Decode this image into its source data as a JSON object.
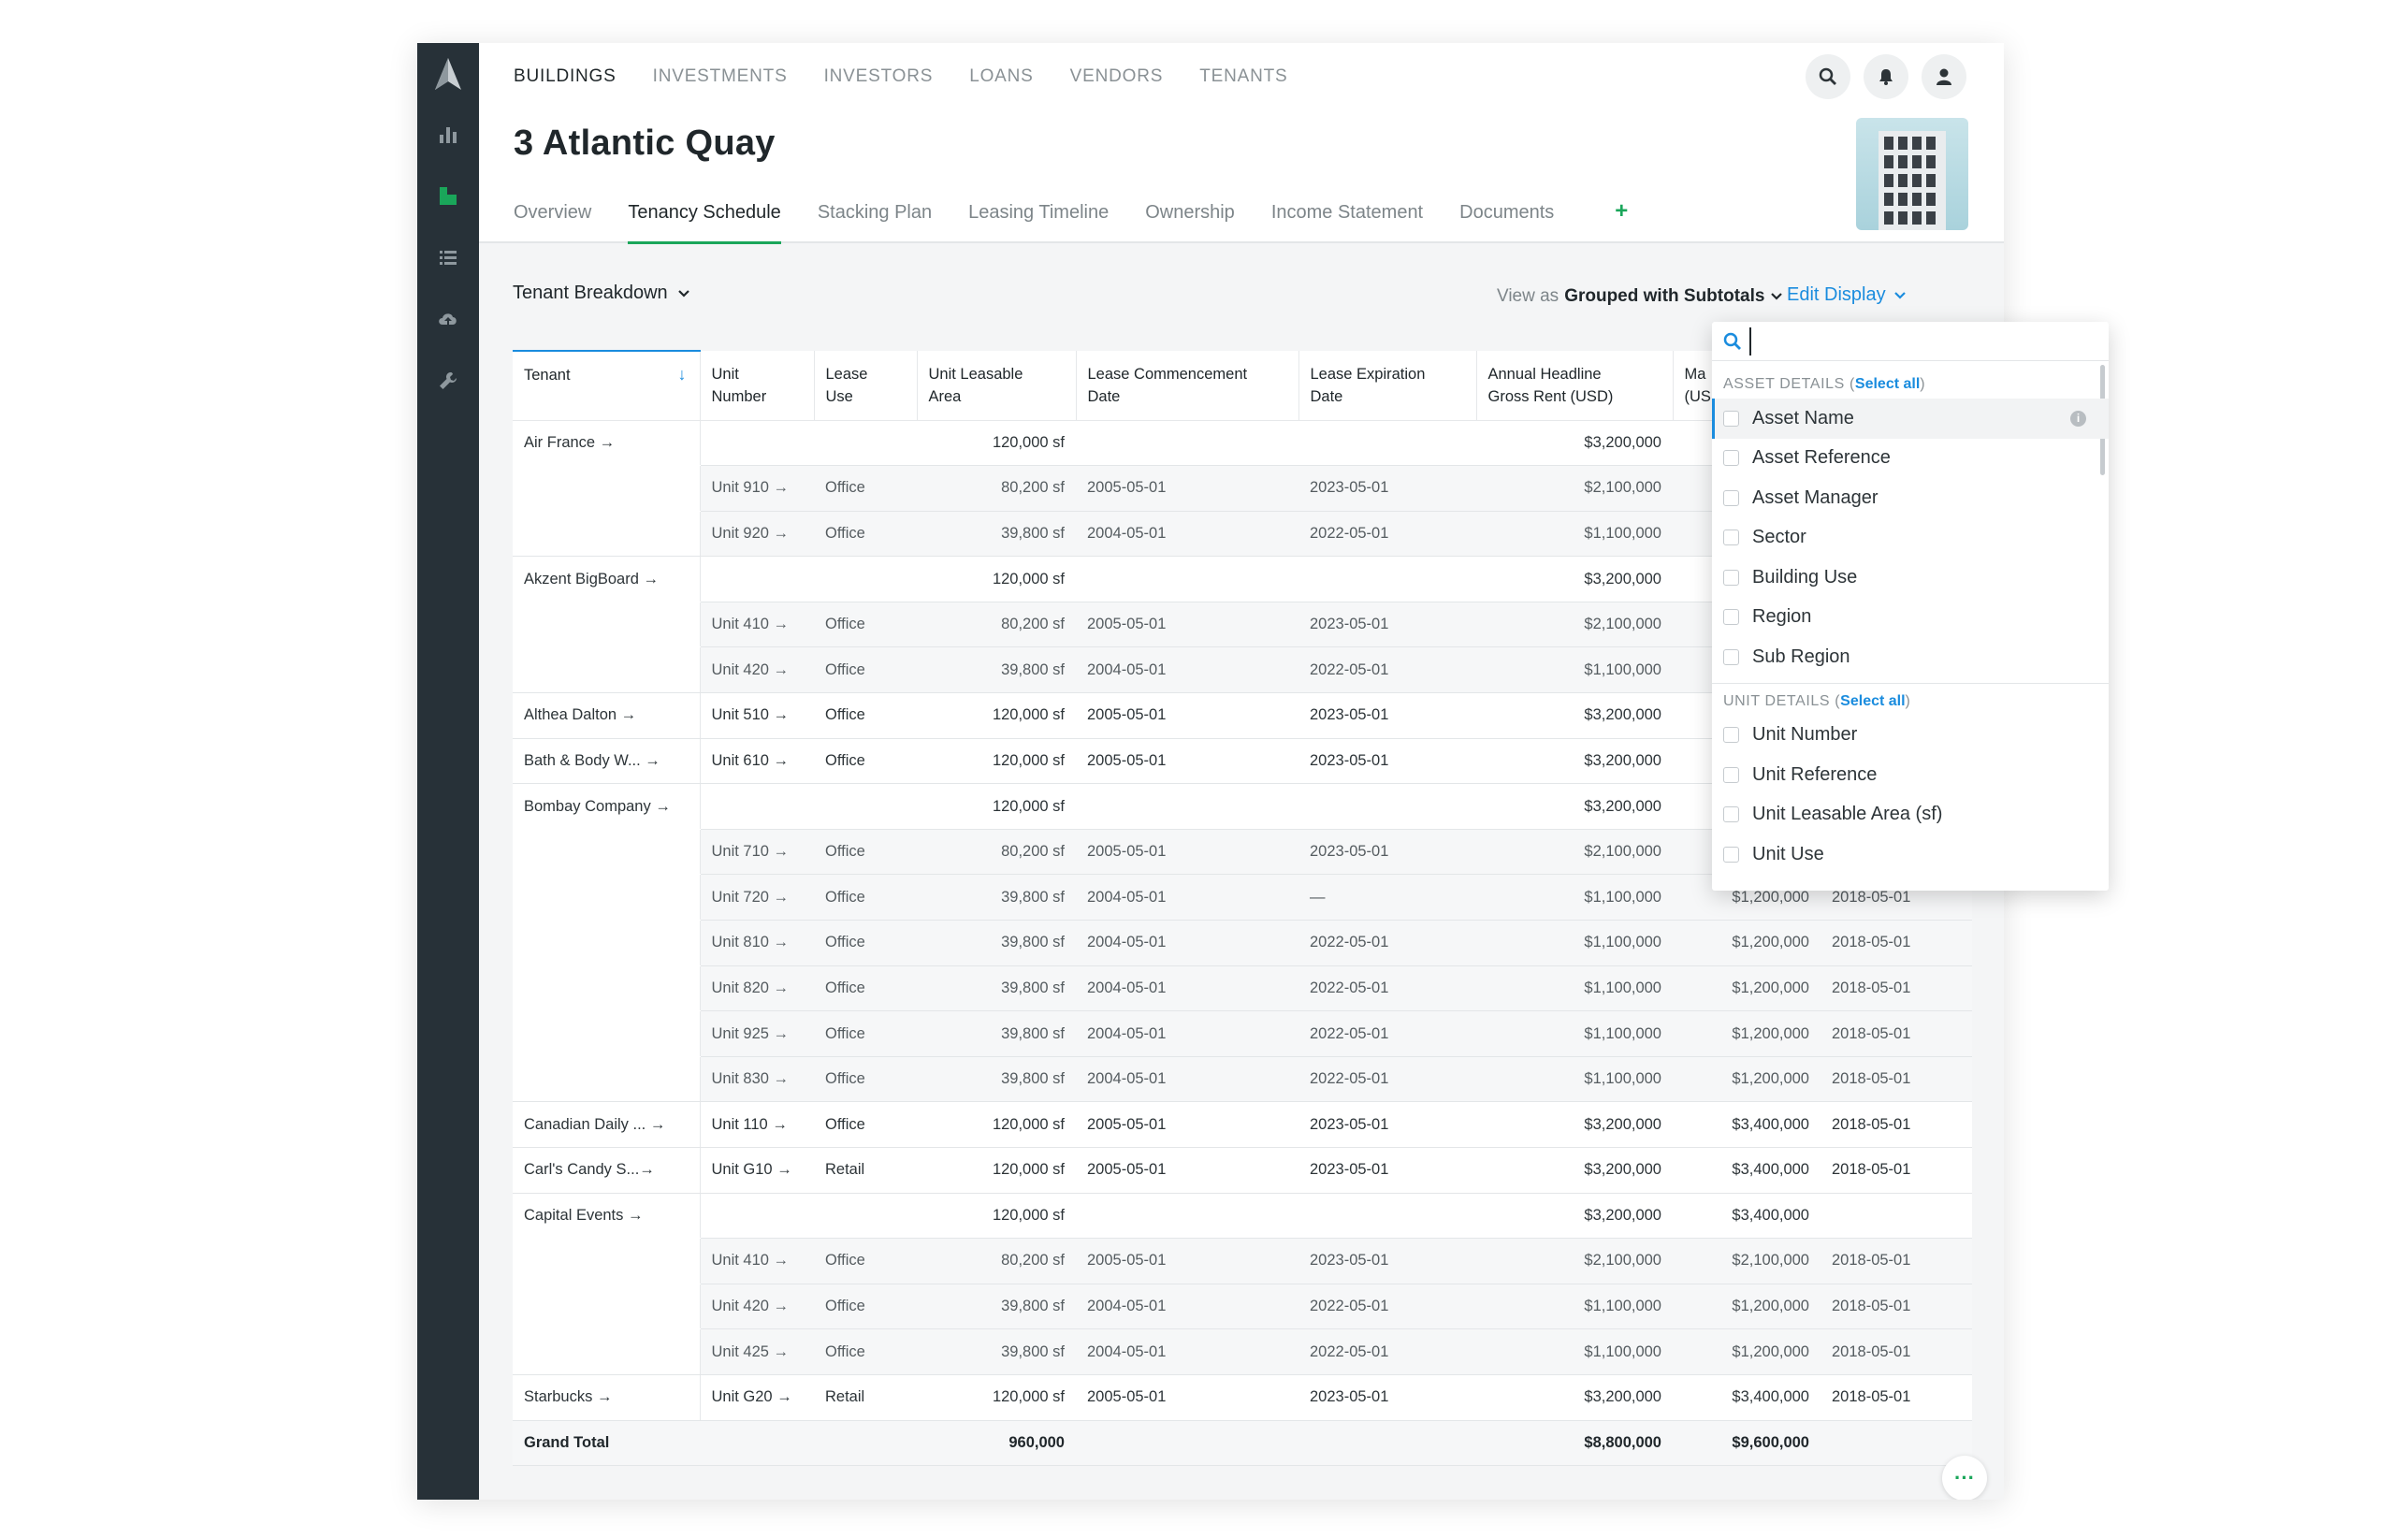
{
  "nav": {
    "items": [
      "BUILDINGS",
      "INVESTMENTS",
      "INVESTORS",
      "LOANS",
      "VENDORS",
      "TENANTS"
    ],
    "active": "BUILDINGS"
  },
  "page": {
    "title": "3 Atlantic Quay"
  },
  "tabs": {
    "items": [
      "Overview",
      "Tenancy Schedule",
      "Stacking Plan",
      "Leasing Timeline",
      "Ownership",
      "Income Statement",
      "Documents"
    ],
    "active": "Tenancy Schedule",
    "add": "+"
  },
  "toolbar": {
    "breakdown": "Tenant Breakdown",
    "view_as_label": "View as",
    "view_as_value": "Grouped with Subtotals",
    "edit_display": "Edit Display"
  },
  "table": {
    "headers": [
      "Tenant",
      "Unit Number",
      "Lease Use",
      "Unit Leasable Area",
      "Lease Commencement Date",
      "Lease Expiration Date",
      "Annual Headline Gross Rent (USD)",
      "Market Rent (USD)",
      ""
    ],
    "header_lines": [
      [
        "Tenant"
      ],
      [
        "Unit",
        "Number"
      ],
      [
        "Lease",
        "Use"
      ],
      [
        "Unit Leasable",
        "Area"
      ],
      [
        "Lease Commencement",
        "Date"
      ],
      [
        "Lease Expiration",
        "Date"
      ],
      [
        "Annual Headline",
        "Gross Rent (USD)"
      ],
      [
        "Ma",
        "(US"
      ],
      [
        ""
      ]
    ],
    "rows": [
      {
        "kind": "group",
        "cells": [
          "Air France →",
          "",
          "",
          "120,000 sf",
          "",
          "",
          "$3,200,000",
          "",
          ""
        ]
      },
      {
        "kind": "sub",
        "cells": [
          "",
          "Unit 910 →",
          "Office",
          "80,200 sf",
          "2005-05-01",
          "2023-05-01",
          "$2,100,000",
          "",
          ""
        ]
      },
      {
        "kind": "sub",
        "cells": [
          "",
          "Unit 920 →",
          "Office",
          "39,800 sf",
          "2004-05-01",
          "2022-05-01",
          "$1,100,000",
          "",
          ""
        ]
      },
      {
        "kind": "group",
        "cells": [
          "Akzent BigBoard →",
          "",
          "",
          "120,000 sf",
          "",
          "",
          "$3,200,000",
          "",
          ""
        ]
      },
      {
        "kind": "sub",
        "cells": [
          "",
          "Unit 410 →",
          "Office",
          "80,200 sf",
          "2005-05-01",
          "2023-05-01",
          "$2,100,000",
          "",
          ""
        ]
      },
      {
        "kind": "sub",
        "cells": [
          "",
          "Unit 420 →",
          "Office",
          "39,800 sf",
          "2004-05-01",
          "2022-05-01",
          "$1,100,000",
          "",
          ""
        ]
      },
      {
        "kind": "group",
        "cells": [
          "Althea Dalton →",
          "Unit 510 →",
          "Office",
          "120,000 sf",
          "2005-05-01",
          "2023-05-01",
          "$3,200,000",
          "",
          ""
        ]
      },
      {
        "kind": "group",
        "cells": [
          "Bath & Body W... →",
          "Unit 610 →",
          "Office",
          "120,000 sf",
          "2005-05-01",
          "2023-05-01",
          "$3,200,000",
          "",
          ""
        ]
      },
      {
        "kind": "group",
        "cells": [
          "Bombay Company →",
          "",
          "",
          "120,000 sf",
          "",
          "",
          "$3,200,000",
          "",
          ""
        ]
      },
      {
        "kind": "sub",
        "cells": [
          "",
          "Unit 710 →",
          "Office",
          "80,200 sf",
          "2005-05-01",
          "2023-05-01",
          "$2,100,000",
          "",
          ""
        ]
      },
      {
        "kind": "sub",
        "cells": [
          "",
          "Unit 720 →",
          "Office",
          "39,800 sf",
          "2004-05-01",
          "—",
          "$1,100,000",
          "$1,200,000",
          "2018-05-01"
        ]
      },
      {
        "kind": "sub",
        "cells": [
          "",
          "Unit 810 →",
          "Office",
          "39,800 sf",
          "2004-05-01",
          "2022-05-01",
          "$1,100,000",
          "$1,200,000",
          "2018-05-01"
        ]
      },
      {
        "kind": "sub",
        "cells": [
          "",
          "Unit 820 →",
          "Office",
          "39,800 sf",
          "2004-05-01",
          "2022-05-01",
          "$1,100,000",
          "$1,200,000",
          "2018-05-01"
        ]
      },
      {
        "kind": "sub",
        "cells": [
          "",
          "Unit 925 →",
          "Office",
          "39,800 sf",
          "2004-05-01",
          "2022-05-01",
          "$1,100,000",
          "$1,200,000",
          "2018-05-01"
        ]
      },
      {
        "kind": "sub",
        "cells": [
          "",
          "Unit 830 →",
          "Office",
          "39,800 sf",
          "2004-05-01",
          "2022-05-01",
          "$1,100,000",
          "$1,200,000",
          "2018-05-01"
        ]
      },
      {
        "kind": "group",
        "cells": [
          "Canadian Daily ... →",
          "Unit 110 →",
          "Office",
          "120,000 sf",
          "2005-05-01",
          "2023-05-01",
          "$3,200,000",
          "$3,400,000",
          "2018-05-01"
        ]
      },
      {
        "kind": "group",
        "cells": [
          "Carl's Candy S...→",
          "Unit G10 →",
          "Retail",
          "120,000 sf",
          "2005-05-01",
          "2023-05-01",
          "$3,200,000",
          "$3,400,000",
          "2018-05-01"
        ]
      },
      {
        "kind": "group",
        "cells": [
          "Capital Events →",
          "",
          "",
          "120,000 sf",
          "",
          "",
          "$3,200,000",
          "$3,400,000",
          ""
        ]
      },
      {
        "kind": "sub",
        "cells": [
          "",
          "Unit 410 →",
          "Office",
          "80,200 sf",
          "2005-05-01",
          "2023-05-01",
          "$2,100,000",
          "$2,100,000",
          "2018-05-01"
        ]
      },
      {
        "kind": "sub",
        "cells": [
          "",
          "Unit 420 →",
          "Office",
          "39,800 sf",
          "2004-05-01",
          "2022-05-01",
          "$1,100,000",
          "$1,200,000",
          "2018-05-01"
        ]
      },
      {
        "kind": "sub",
        "cells": [
          "",
          "Unit 425 →",
          "Office",
          "39,800 sf",
          "2004-05-01",
          "2022-05-01",
          "$1,100,000",
          "$1,200,000",
          "2018-05-01"
        ]
      },
      {
        "kind": "group",
        "cells": [
          "Starbucks →",
          "Unit G20 →",
          "Retail",
          "120,000 sf",
          "2005-05-01",
          "2023-05-01",
          "$3,200,000",
          "$3,400,000",
          "2018-05-01"
        ]
      },
      {
        "kind": "total",
        "cells": [
          "Grand Total",
          "",
          "",
          "960,000",
          "",
          "",
          "$8,800,000",
          "$9,600,000",
          ""
        ]
      }
    ]
  },
  "dropdown": {
    "search_placeholder": "",
    "asset_section": "ASSET DETAILS",
    "unit_section": "UNIT DETAILS",
    "select_all": "Select all",
    "asset_items": [
      "Asset Name",
      "Asset Reference",
      "Asset Manager",
      "Sector",
      "Building Use",
      "Region",
      "Sub Region"
    ],
    "unit_items": [
      "Unit Number",
      "Unit Reference",
      "Unit Leasable Area (sf)",
      "Unit Use"
    ]
  },
  "fab": {
    "label": "···"
  },
  "colors": {
    "accent_green": "#1aa65a",
    "link_blue": "#1a8cde",
    "rail": "#273138"
  }
}
